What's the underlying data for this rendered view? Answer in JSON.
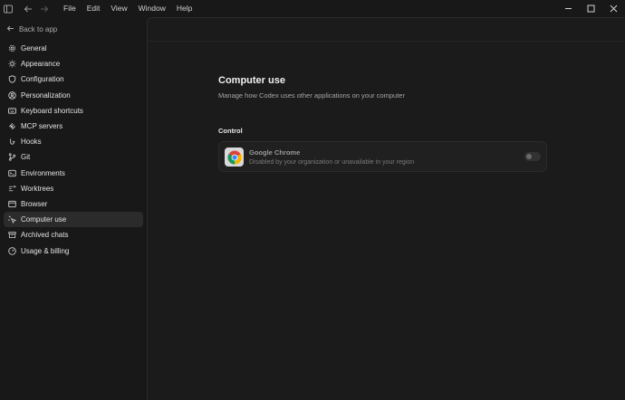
{
  "menu": [
    "File",
    "Edit",
    "View",
    "Window",
    "Help"
  ],
  "sidebar": {
    "back_label": "Back to app",
    "items": [
      {
        "label": "General",
        "icon": "gear-icon"
      },
      {
        "label": "Appearance",
        "icon": "sun-icon"
      },
      {
        "label": "Configuration",
        "icon": "shield-icon"
      },
      {
        "label": "Personalization",
        "icon": "person-icon"
      },
      {
        "label": "Keyboard shortcuts",
        "icon": "keyboard-icon"
      },
      {
        "label": "MCP servers",
        "icon": "mcp-icon"
      },
      {
        "label": "Hooks",
        "icon": "hook-icon"
      },
      {
        "label": "Git",
        "icon": "git-branch-icon"
      },
      {
        "label": "Environments",
        "icon": "environment-icon"
      },
      {
        "label": "Worktrees",
        "icon": "worktree-icon"
      },
      {
        "label": "Browser",
        "icon": "browser-icon"
      },
      {
        "label": "Computer use",
        "icon": "sparkle-cursor-icon",
        "active": true
      },
      {
        "label": "Archived chats",
        "icon": "archive-icon"
      },
      {
        "label": "Usage & billing",
        "icon": "gauge-icon"
      }
    ]
  },
  "main": {
    "title": "Computer use",
    "subtitle": "Manage how Codex uses other applications on your computer",
    "section": "Control",
    "app": {
      "name": "Google Chrome",
      "description": "Disabled by your organization or unavailable in your region",
      "enabled": false,
      "icon": "chrome-icon"
    }
  },
  "colors": {
    "background": "#181818",
    "panel": "#1b1b1b",
    "active_item": "#2b2b2b"
  }
}
